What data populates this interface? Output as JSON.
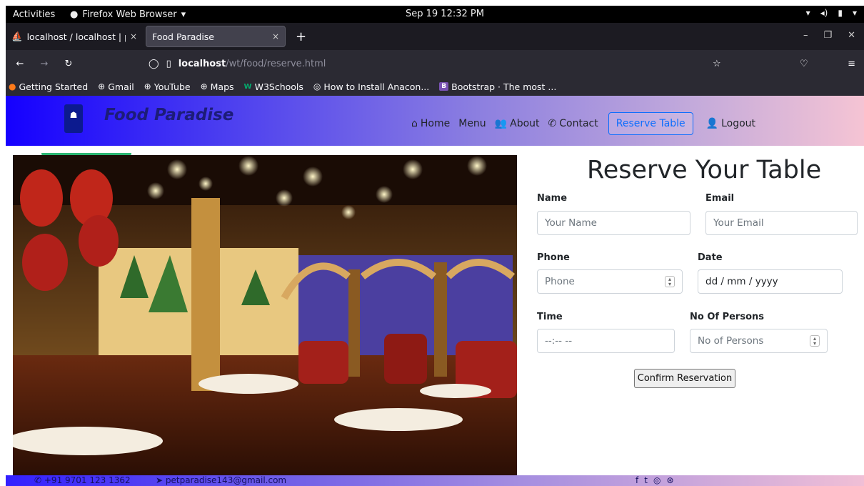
{
  "system_bar": {
    "activities": "Activities",
    "app_name": "Firefox Web Browser",
    "clock": "Sep 19  12:32 PM"
  },
  "browser": {
    "tabs": [
      {
        "title": "localhost / localhost | php",
        "close": "×"
      },
      {
        "title": "Food Paradise",
        "close": "×"
      }
    ],
    "new_tab": "+",
    "url_host": "localhost",
    "url_path": "/wt/food/reserve.html",
    "bookmarks": [
      "Getting Started",
      "Gmail",
      "YouTube",
      "Maps",
      "W3Schools",
      "How to Install Anacon...",
      "Bootstrap · The most ..."
    ]
  },
  "site": {
    "brand": "Food Paradise",
    "nav": {
      "home": "Home",
      "menu": "Menu",
      "about": "About",
      "contact": "Contact",
      "reserve": "Reserve Table",
      "logout": "Logout"
    }
  },
  "form": {
    "title": "Reserve Your Table",
    "name_label": "Name",
    "name_placeholder": "Your Name",
    "email_label": "Email",
    "email_placeholder": "Your Email",
    "phone_label": "Phone",
    "phone_placeholder": "Phone",
    "date_label": "Date",
    "date_value": "dd / mm / yyyy",
    "time_label": "Time",
    "time_value": "--:-- --",
    "persons_label": "No Of Persons",
    "persons_placeholder": "No of Persons",
    "submit": "Confirm Reservation"
  },
  "footer": {
    "phone": "+91 9701 123 1362",
    "email": "petparadise143@gmail.com"
  },
  "colors": {
    "header_start": "#1500ff",
    "header_end": "#f5c4d4",
    "reserve_accent": "#0d6efd",
    "brand_text": "#1c1c78"
  }
}
